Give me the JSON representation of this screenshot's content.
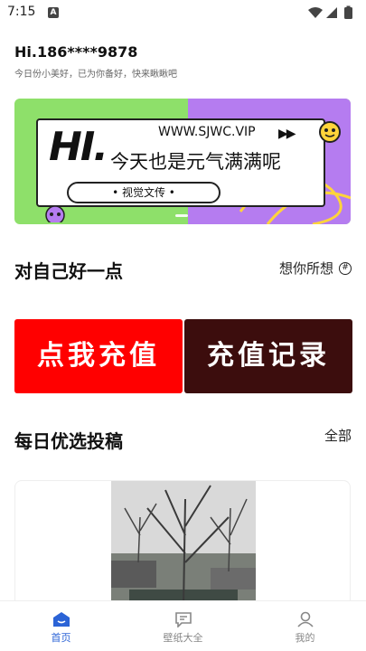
{
  "status": {
    "time": "7:15",
    "notif_glyph": "A"
  },
  "greeting": {
    "title": "Hi.186****9878",
    "subtitle": "今日份小美好，已为你备好，快来瞅瞅吧"
  },
  "banner": {
    "hi": "HI.",
    "url": "WWW.SJWC.VIP",
    "play": "▶▶",
    "main": "今天也是元气满满呢",
    "pill": "• 视觉文传 •",
    "colors": {
      "left": "#8ee06a",
      "right": "#b57cf0",
      "accent": "#ffd43a"
    }
  },
  "section1": {
    "title": "对自己好一点",
    "link": "想你所想",
    "link_icon": "hash-circle-icon"
  },
  "actions": {
    "recharge": "点我充值",
    "record": "充值记录",
    "colors": {
      "recharge": "#ff0000",
      "record": "#3c0d0d"
    }
  },
  "section2": {
    "title": "每日优选投稿",
    "link": "全部"
  },
  "tabs": [
    {
      "label": "首页",
      "icon": "home-icon",
      "active": true
    },
    {
      "label": "壁纸大全",
      "icon": "chat-icon",
      "active": false
    },
    {
      "label": "我的",
      "icon": "user-icon",
      "active": false
    }
  ],
  "colors": {
    "tab_active": "#2b63d6",
    "tab_inactive": "#888888"
  }
}
